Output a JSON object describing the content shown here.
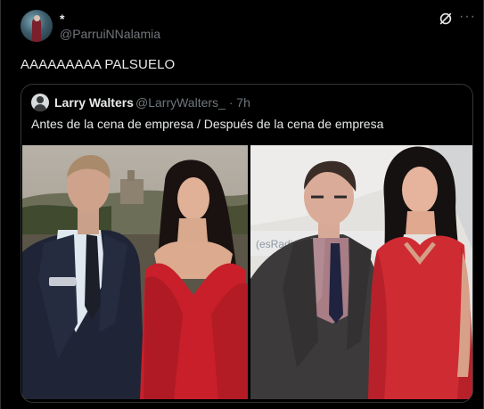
{
  "author": {
    "display_name": "*",
    "handle": "@ParruiNNalamia"
  },
  "post": {
    "text": "AAAAAAAAA PALSUELO"
  },
  "icons": {
    "grok": "grok-icon",
    "more": "more-icon"
  },
  "quoted": {
    "display_name": "Larry Walters",
    "handle": "@LarryWalters_",
    "separator": "·",
    "time": "7h",
    "text": "Antes de la cena de empresa / Después de la cena de empresa",
    "images": [
      "photo of a man in a pinstriped suit and a woman in a red dress",
      "photo of a man in a grey suit and a woman in a red dress"
    ]
  },
  "colors": {
    "background": "#000000",
    "text_primary": "#e7e9ea",
    "text_secondary": "#71767b",
    "border": "#333639",
    "dress_red": "#c81f2a"
  }
}
